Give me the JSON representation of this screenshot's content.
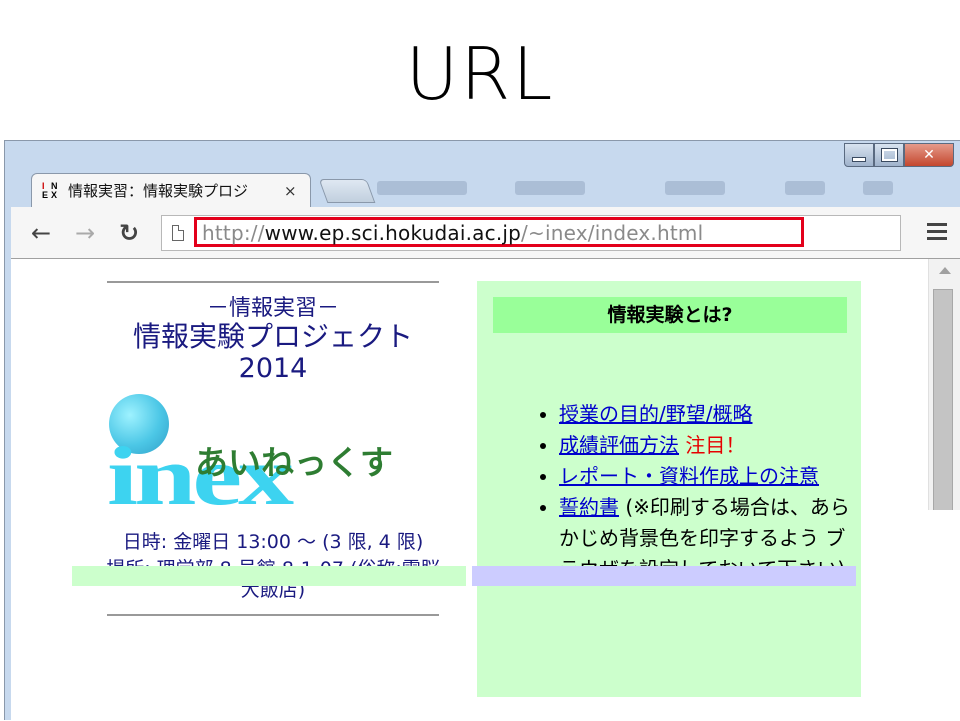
{
  "slide": {
    "title": "URL"
  },
  "browser": {
    "tab": {
      "title": "情報実習：情報実験プロジ",
      "close": "×",
      "favicon_text": [
        "I",
        "N",
        "E",
        "X"
      ]
    },
    "nav": {
      "back": "←",
      "forward": "→",
      "reload": "↻"
    },
    "url": {
      "scheme": "http://",
      "host": "www.ep.sci.hokudai.ac.jp",
      "path": "/~inex/index.html",
      "highlight_color": "#e3001b"
    },
    "icons": [
      "back-arrow-icon",
      "forward-arrow-icon",
      "reload-icon",
      "page-icon",
      "menu-icon",
      "close-icon",
      "minimize-icon",
      "maximize-icon"
    ]
  },
  "page": {
    "subtitle": "－情報実習－",
    "title": "情報実験プロジェクト",
    "year": "2014",
    "logo": {
      "text": "inex",
      "kana": "あいねっくす"
    },
    "schedule": "日時: 金曜日 13:00 ～ (3 限, 4 限)",
    "place": "場所: 理学部 8 号館 8-1-07 (俗称:電脳大飯店)",
    "panel": {
      "heading": "情報実験とは?",
      "items": [
        {
          "link": "授業の目的/野望/概略",
          "note": "",
          "alert": ""
        },
        {
          "link": "成績評価方法",
          "note": "",
          "alert": "注目！"
        },
        {
          "link": "レポート・資料作成上の注意",
          "note": "",
          "alert": ""
        },
        {
          "link": "誓約書",
          "note": "(※印刷する場合は、あらかじめ背景色を印字するよう ブラウザを設定しておいて下さい)",
          "alert": ""
        }
      ]
    },
    "colors": {
      "panel_bg": "#ccffcc",
      "panel_head": "#99ff99",
      "link": "#0000cc",
      "alert": "#e60000",
      "title_text": "#1a1a80"
    }
  }
}
